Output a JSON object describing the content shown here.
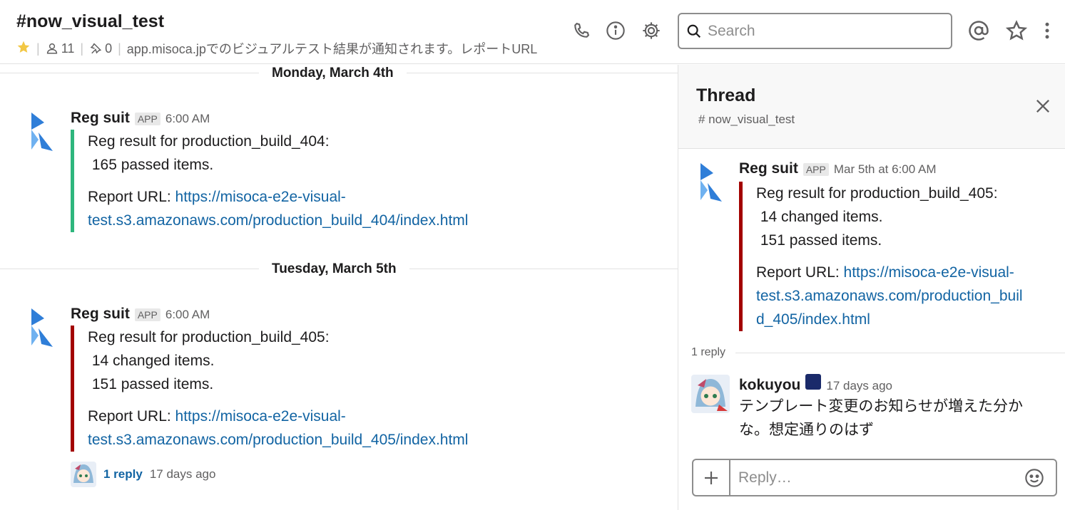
{
  "header": {
    "channel": "#now_visual_test",
    "members": "11",
    "pins": "0",
    "topic": "app.misoca.jpでのビジュアルテスト結果が通知されます。レポートURL",
    "search_placeholder": "Search",
    "icons": [
      "star-icon",
      "person-icon",
      "pin-icon",
      "phone-icon",
      "info-icon",
      "gear-icon",
      "search-icon",
      "at-icon",
      "star-outline-icon",
      "more-vertical-icon"
    ]
  },
  "main": {
    "days": [
      {
        "label": "Monday, March 4th",
        "message": {
          "sender": "Reg suit",
          "badge": "APP",
          "time": "6:00 AM",
          "accent": "#2eb67d",
          "lines": [
            "Reg result for production_build_404:",
            " 165 passed items."
          ],
          "report_prefix": "Report URL: ",
          "url_part1": "https://misoca-e2e-visual-",
          "url_part2": "test.s3.amazonaws.com/production_build_404/index.html"
        }
      },
      {
        "label": "Tuesday, March 5th",
        "message": {
          "sender": "Reg suit",
          "badge": "APP",
          "time": "6:00 AM",
          "accent": "#a30200",
          "lines": [
            "Reg result for production_build_405:",
            " 14 changed items.",
            " 151 passed items."
          ],
          "report_prefix": "Report URL: ",
          "url_part1": "https://misoca-e2e-visual-",
          "url_part2": "test.s3.amazonaws.com/production_build_405/index.html",
          "reply_count": "1 reply",
          "reply_ago": "17 days ago"
        }
      }
    ]
  },
  "thread": {
    "title": "Thread",
    "channel": "# now_visual_test",
    "parent": {
      "sender": "Reg suit",
      "badge": "APP",
      "time": "Mar 5th at 6:00 AM",
      "lines": [
        "Reg result for production_build_405:",
        " 14 changed items.",
        " 151 passed items."
      ],
      "report_prefix": "Report URL: ",
      "url_part1": "https://misoca-e2e-visual-",
      "url_part2": "test.s3.amazonaws.com/production_buil",
      "url_part3": "d_405/index.html"
    },
    "reply_separator": "1 reply",
    "reply": {
      "sender": "kokuyou",
      "time": "17 days ago",
      "text_line1": "テンプレート変更のお知らせが増えた分か",
      "text_line2": "な。想定通りのはず"
    },
    "composer_placeholder": "Reply…"
  },
  "colors": {
    "link": "#1264a3",
    "green_accent": "#2eb67d",
    "red_accent": "#a30200"
  }
}
